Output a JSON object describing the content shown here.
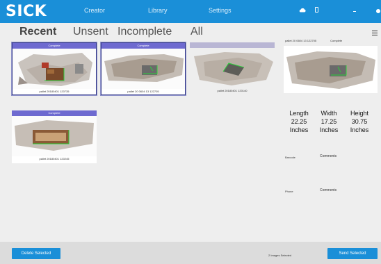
{
  "app": {
    "logo": "SICK",
    "nav": {
      "creator": "Creator",
      "library": "Library",
      "settings": "Settings"
    },
    "status_icons": [
      "cloud-icon",
      "battery-icon"
    ],
    "accent_color": "#1a8fd8"
  },
  "filters": {
    "recent": "Recent",
    "unsent": "Unsent",
    "incomplete": "Incomplete",
    "all": "All"
  },
  "cards": [
    {
      "header": "Complete",
      "label": "pallet 20180401 120735",
      "selected": true
    },
    {
      "header": "Complete",
      "label": "pallet 20 0604 13 122705",
      "selected": true
    },
    {
      "header": "",
      "label": "pallet 20180401 120140",
      "selected": false
    },
    {
      "header": "Complete",
      "label": "pallet 20180401 120245",
      "selected": false
    }
  ],
  "detail": {
    "caption": "pallet 20 0604 13 122705",
    "status": "Complete",
    "length_label": "Length",
    "length_value": "22.25",
    "length_unit": "Inches",
    "width_label": "Width",
    "width_value": "17.25",
    "width_unit": "Inches",
    "height_label": "Height",
    "height_value": "30.75",
    "height_unit": "Inches",
    "barcode_label": "Barcode",
    "barcode_value": "Comments",
    "phone_label": "Phone",
    "phone_value": "Comments"
  },
  "footer": {
    "delete_button": "Delete Selected",
    "selected_text": "2 Images Selected",
    "send_button": "Send Selected"
  }
}
